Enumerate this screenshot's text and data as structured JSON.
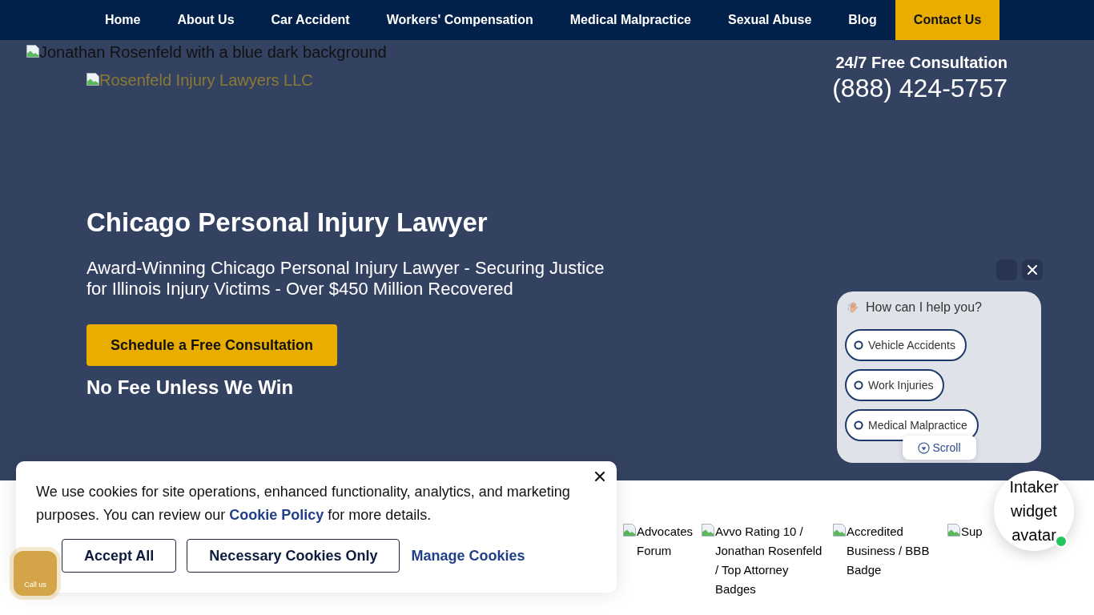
{
  "nav": {
    "items": [
      {
        "label": "Home",
        "selected": false
      },
      {
        "label": "About Us",
        "selected": false
      },
      {
        "label": "Car Accident",
        "selected": false
      },
      {
        "label": "Workers' Compensation",
        "selected": false
      },
      {
        "label": "Medical Malpractice",
        "selected": false
      },
      {
        "label": "Sexual Abuse",
        "selected": false
      },
      {
        "label": "Blog",
        "selected": false
      },
      {
        "label": "Contact Us",
        "selected": true
      }
    ]
  },
  "header": {
    "background_image_alt": "Jonathan Rosenfeld with a blue dark background",
    "logo_alt": "Rosenfeld Injury Lawyers LLC",
    "consultation_label": "24/7 Free Consultation",
    "phone": "(888) 424-5757"
  },
  "hero": {
    "title": "Chicago Personal Injury Lawyer",
    "subtitle": "Award-Winning Chicago Personal Injury Lawyer - Securing Justice for Illinois Injury Victims - Over $450 Million Recovered",
    "cta_button": "Schedule a Free Consultation",
    "tagline": "No Fee Unless We Win"
  },
  "badges": [
    {
      "alt": "Advocates Forum"
    },
    {
      "alt": "Avvo Rating 10 / Jonathan Rosenfeld / Top Attorney Badges"
    },
    {
      "alt": "Accredited Business / BBB Badge"
    },
    {
      "alt": "Sup"
    }
  ],
  "chat_widget": {
    "prompt": "How can I help you?",
    "options": [
      "Vehicle Accidents",
      "Work Injuries",
      "Medical Malpractice"
    ],
    "scroll_button": "Scroll",
    "avatar": {
      "alt": "Intaker widget avatar",
      "online": true
    }
  },
  "call_button": {
    "label": "Call us"
  },
  "cookie_banner": {
    "message_before": "We use cookies for site operations, enhanced functionality, analytics, and marketing purposes. You can review our ",
    "link": "Cookie Policy",
    "message_after": " for more details.",
    "buttons": [
      {
        "label": "Accept All",
        "kind": "outline"
      },
      {
        "label": "Necessary Cookies Only",
        "kind": "outline"
      },
      {
        "label": "Manage Cookies",
        "kind": "link"
      }
    ]
  }
}
